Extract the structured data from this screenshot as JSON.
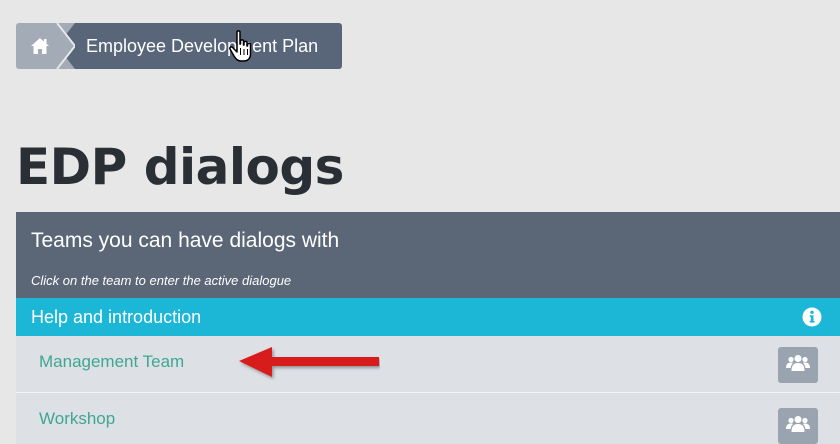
{
  "breadcrumb": {
    "home_icon": "home-icon",
    "current_label": "Employee Development Plan"
  },
  "page": {
    "title": "EDP dialogs"
  },
  "panel": {
    "title": "Teams you can have dialogs with",
    "subtitle": "Click on the team to enter the active dialogue",
    "help_label": "Help and introduction",
    "help_icon": "info-icon",
    "teams": [
      {
        "label": "Management Team",
        "icon": "team-icon"
      },
      {
        "label": "Workshop",
        "icon": "team-icon"
      }
    ]
  },
  "colors": {
    "header_bg": "#5b6677",
    "help_bg": "#1cb7d6",
    "link": "#3fa690",
    "annotation_arrow": "#d81e1e"
  }
}
